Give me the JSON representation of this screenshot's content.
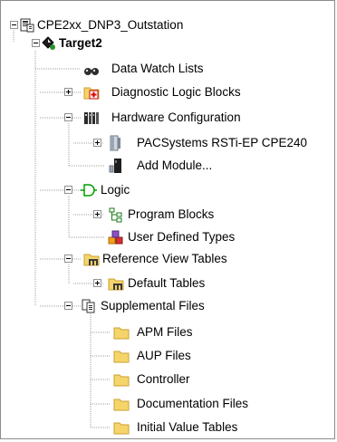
{
  "tree": {
    "root": {
      "label": "CPE2xx_DNP3_Outstation",
      "expanded": true
    },
    "target": {
      "label": "Target2",
      "expanded": true
    },
    "data_watch_lists": {
      "label": "Data Watch Lists"
    },
    "diagnostic_logic_blocks": {
      "label": "Diagnostic Logic Blocks",
      "expanded": false
    },
    "hardware_configuration": {
      "label": "Hardware Configuration",
      "expanded": true
    },
    "pacsystems": {
      "label": "PACSystems RSTi-EP CPE240",
      "expanded": false
    },
    "add_module": {
      "label": "Add Module..."
    },
    "logic": {
      "label": "Logic",
      "expanded": true
    },
    "program_blocks": {
      "label": "Program Blocks",
      "expanded": false
    },
    "user_defined_types": {
      "label": "User Defined Types"
    },
    "reference_view_tables": {
      "label": "Reference View Tables",
      "expanded": true
    },
    "default_tables": {
      "label": "Default Tables",
      "expanded": false
    },
    "supplemental_files": {
      "label": "Supplemental Files",
      "expanded": true
    },
    "apm_files": {
      "label": "APM Files"
    },
    "aup_files": {
      "label": "AUP Files"
    },
    "controller": {
      "label": "Controller"
    },
    "documentation_files": {
      "label": "Documentation Files"
    },
    "initial_value_tables": {
      "label": "Initial Value Tables"
    }
  },
  "colors": {
    "folder": "#f5d46a",
    "folder_edge": "#c9a233",
    "tree_line": "#a0a0a0",
    "expander_border": "#919191"
  }
}
